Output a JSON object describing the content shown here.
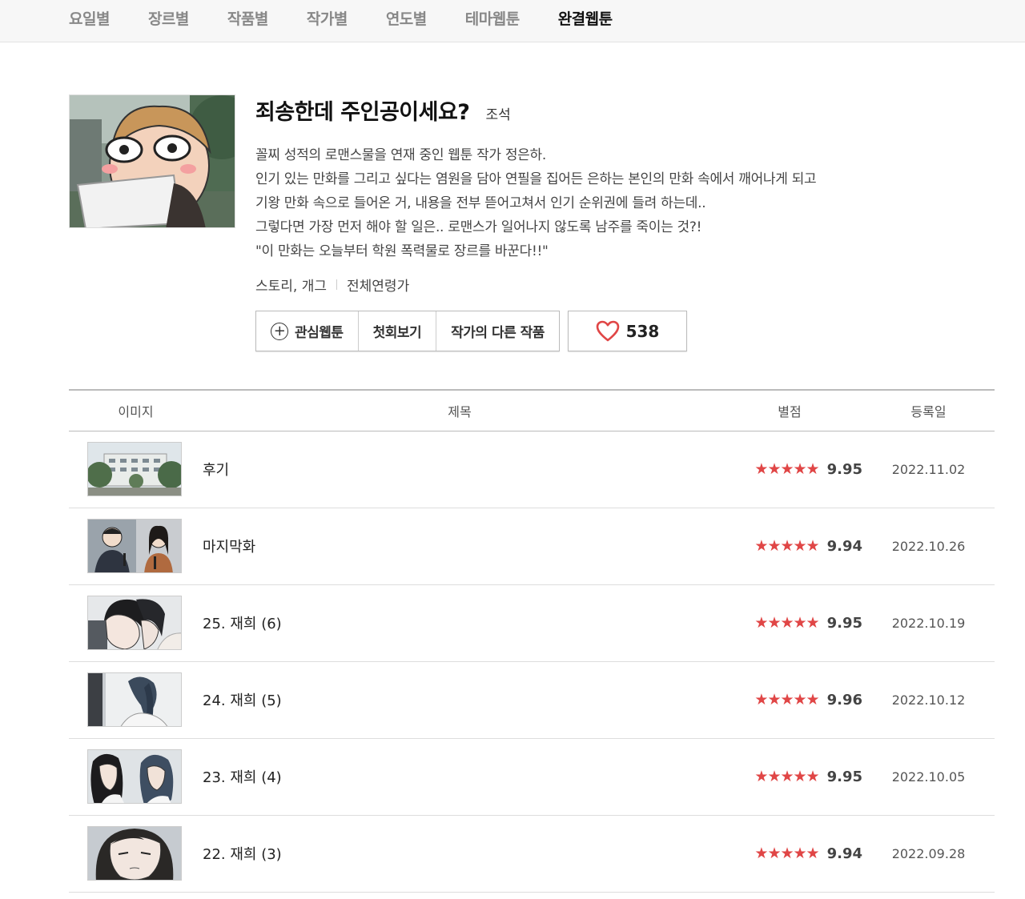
{
  "nav": {
    "items": [
      {
        "label": "요일별",
        "active": false
      },
      {
        "label": "장르별",
        "active": false
      },
      {
        "label": "작품별",
        "active": false
      },
      {
        "label": "작가별",
        "active": false
      },
      {
        "label": "연도별",
        "active": false
      },
      {
        "label": "테마웹툰",
        "active": false
      },
      {
        "label": "완결웹툰",
        "active": true
      }
    ]
  },
  "comic": {
    "title": "죄송한데 주인공이세요?",
    "author": "조석",
    "description": [
      "꼴찌 성적의 로맨스물을 연재 중인 웹툰 작가 정은하.",
      "인기 있는 만화를 그리고 싶다는 염원을 담아 연필을 집어든 은하는 본인의 만화 속에서 깨어나게 되고",
      "기왕 만화 속으로 들어온 거, 내용을 전부 뜯어고쳐서 인기 순위권에 들려 하는데..",
      "그렇다면 가장 먼저 해야 할 일은.. 로맨스가 일어나지 않도록 남주를 죽이는 것?!",
      "\"이 만화는 오늘부터 학원 폭력물로 장르를 바꾼다!!\""
    ],
    "genre": "스토리, 개그",
    "age": "전체연령가",
    "buttons": {
      "favorite": "관심웹툰",
      "first": "첫회보기",
      "other_works": "작가의 다른 작품"
    },
    "likes": "538"
  },
  "table": {
    "headers": {
      "image": "이미지",
      "title": "제목",
      "rating": "별점",
      "date": "등록일"
    },
    "stars": "★★★★★",
    "rows": [
      {
        "title": "후기",
        "rating": "9.95",
        "date": "2022.11.02",
        "thumb": "school"
      },
      {
        "title": "마지막화",
        "rating": "9.94",
        "date": "2022.10.26",
        "thumb": "interview"
      },
      {
        "title": "25. 재희 (6)",
        "rating": "9.95",
        "date": "2022.10.19",
        "thumb": "profile"
      },
      {
        "title": "24. 재희 (5)",
        "rating": "9.96",
        "date": "2022.10.12",
        "thumb": "ponytail"
      },
      {
        "title": "23. 재희 (4)",
        "rating": "9.95",
        "date": "2022.10.05",
        "thumb": "two-girls"
      },
      {
        "title": "22. 재희 (3)",
        "rating": "9.94",
        "date": "2022.09.28",
        "thumb": "face"
      }
    ]
  },
  "colors": {
    "accent": "#e04646",
    "nav_bg": "#f7f7f7"
  }
}
